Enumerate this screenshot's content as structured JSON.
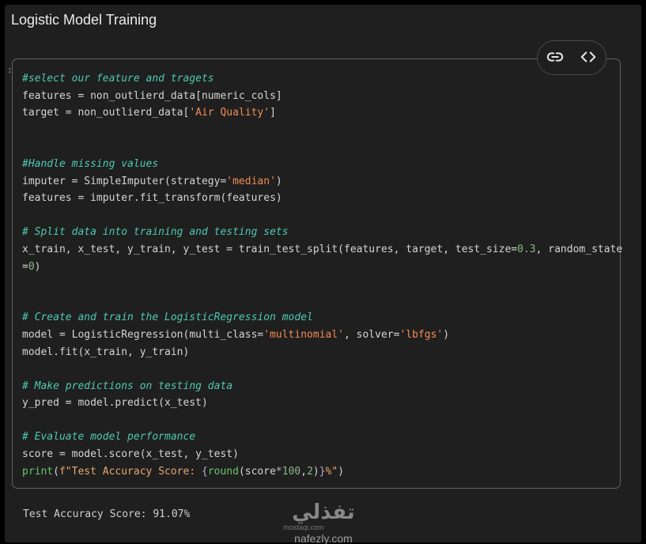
{
  "section": {
    "title": "Logistic Model Training",
    "gutter_mark": ":"
  },
  "toolbar": {
    "link_icon": "link-icon",
    "code_icon": "code-icon"
  },
  "colors": {
    "background": "#1f1f1f",
    "comment": "#4ec9b0",
    "string": "#f28b54",
    "number": "#8bb58b",
    "keyword": "#6ac469"
  },
  "code_lines": [
    {
      "tokens": [
        {
          "t": "#select our feature and tragets",
          "c": "cm"
        }
      ]
    },
    {
      "tokens": [
        {
          "t": "features = non_outlierd_data[numeric_cols]",
          "c": ""
        }
      ]
    },
    {
      "tokens": [
        {
          "t": "target = non_outlierd_data[",
          "c": ""
        },
        {
          "t": "'Air Quality'",
          "c": "st"
        },
        {
          "t": "]",
          "c": ""
        }
      ]
    },
    {
      "tokens": []
    },
    {
      "tokens": []
    },
    {
      "tokens": [
        {
          "t": "#Handle missing values",
          "c": "cm"
        }
      ]
    },
    {
      "tokens": [
        {
          "t": "imputer = SimpleImputer(strategy=",
          "c": ""
        },
        {
          "t": "'median'",
          "c": "st"
        },
        {
          "t": ")",
          "c": ""
        }
      ]
    },
    {
      "tokens": [
        {
          "t": "features = imputer.fit_transform(features)",
          "c": ""
        }
      ]
    },
    {
      "tokens": []
    },
    {
      "tokens": [
        {
          "t": "# Split data into training and testing sets",
          "c": "cm"
        }
      ]
    },
    {
      "tokens": [
        {
          "t": "x_train, x_test, y_train, y_test = train_test_split(features, target, test_size=",
          "c": ""
        },
        {
          "t": "0.3",
          "c": "nu"
        },
        {
          "t": ", random_state",
          "c": ""
        }
      ]
    },
    {
      "tokens": [
        {
          "t": "=",
          "c": ""
        },
        {
          "t": "0",
          "c": "nu"
        },
        {
          "t": ")",
          "c": ""
        }
      ]
    },
    {
      "tokens": []
    },
    {
      "tokens": []
    },
    {
      "tokens": [
        {
          "t": "# Create and train the LogisticRegression model",
          "c": "cm"
        }
      ]
    },
    {
      "tokens": [
        {
          "t": "model = LogisticRegression(multi_class=",
          "c": ""
        },
        {
          "t": "'multinomial'",
          "c": "st"
        },
        {
          "t": ", solver=",
          "c": ""
        },
        {
          "t": "'lbfgs'",
          "c": "st"
        },
        {
          "t": ")",
          "c": ""
        }
      ]
    },
    {
      "tokens": [
        {
          "t": "model.fit(x_train, y_train)",
          "c": ""
        }
      ]
    },
    {
      "tokens": []
    },
    {
      "tokens": [
        {
          "t": "# Make predictions on testing data",
          "c": "cm"
        }
      ]
    },
    {
      "tokens": [
        {
          "t": "y_pred = model.predict(x_test)",
          "c": ""
        }
      ]
    },
    {
      "tokens": []
    },
    {
      "tokens": [
        {
          "t": "# Evaluate model performance",
          "c": "cm"
        }
      ]
    },
    {
      "tokens": [
        {
          "t": "score = model.score(x_test, y_test)",
          "c": ""
        }
      ]
    },
    {
      "tokens": [
        {
          "t": "print",
          "c": "kw"
        },
        {
          "t": "(",
          "c": ""
        },
        {
          "t": "f\"Test Accuracy Score: ",
          "c": "fs"
        },
        {
          "t": "{",
          "c": "op"
        },
        {
          "t": "round",
          "c": "kw"
        },
        {
          "t": "(score",
          "c": ""
        },
        {
          "t": "*",
          "c": "op"
        },
        {
          "t": "100",
          "c": "nu"
        },
        {
          "t": ",",
          "c": ""
        },
        {
          "t": "2",
          "c": "nu"
        },
        {
          "t": ")",
          "c": ""
        },
        {
          "t": "}",
          "c": "op"
        },
        {
          "t": "%\"",
          "c": "fs"
        },
        {
          "t": ")",
          "c": ""
        }
      ]
    }
  ],
  "output": {
    "text": "Test Accuracy Score: 91.07%"
  },
  "watermark": {
    "arabic": "تفذلي",
    "latin_small": "mostaqi.com",
    "latin": "nafezly.com"
  }
}
